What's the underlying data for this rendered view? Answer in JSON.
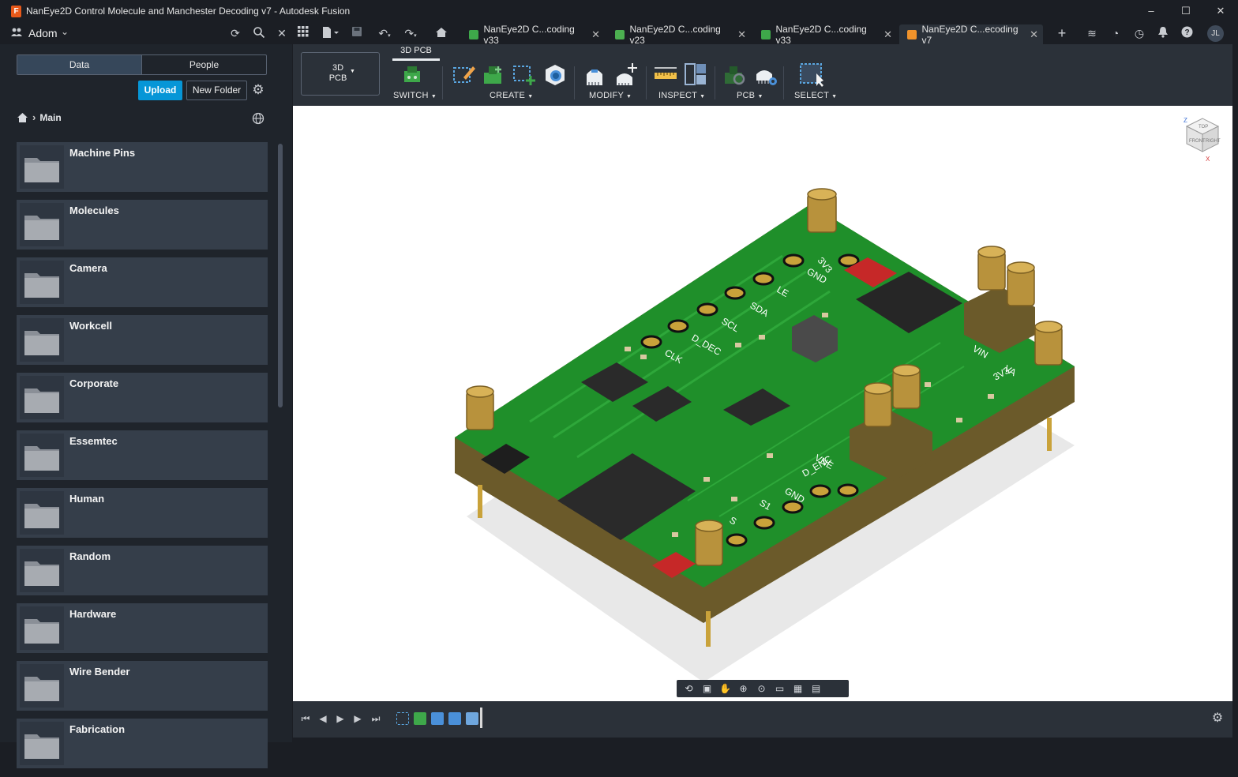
{
  "window": {
    "title": "NanEye2D Control Molecule and Manchester Decoding v7 - Autodesk Fusion",
    "app_icon": "F",
    "controls": [
      "–",
      "☐",
      "✕"
    ]
  },
  "tabbar": {
    "workspace": "Adom",
    "user_initials": "JL",
    "tabs": [
      {
        "label": "NanEye2D C...coding v33",
        "icon": "pcb-schematic-icon",
        "color": "#3ea84a",
        "active": false
      },
      {
        "label": "NanEye2D C...coding v23",
        "icon": "schematic-icon",
        "color": "#4caf50",
        "active": false
      },
      {
        "label": "NanEye2D C...coding v33",
        "icon": "pcb-icon",
        "color": "#3ea84a",
        "active": false
      },
      {
        "label": "NanEye2D C...ecoding v7",
        "icon": "3d-design-icon",
        "color": "#f0932b",
        "active": true
      }
    ]
  },
  "data_panel": {
    "segments": [
      "Data",
      "People"
    ],
    "active_segment": "Data",
    "upload_label": "Upload",
    "new_folder_label": "New Folder",
    "breadcrumb": [
      "Main"
    ],
    "folders": [
      "Machine Pins",
      "Molecules",
      "Camera",
      "Workcell",
      "Corporate",
      "Essemtec",
      "Human",
      "Random",
      "Hardware",
      "Wire Bender",
      "Fabrication"
    ]
  },
  "toolbar": {
    "workspace_switch": {
      "line1": "3D",
      "line2": "PCB"
    },
    "active_tab": "3D PCB",
    "groups": [
      "SWITCH",
      "CREATE",
      "MODIFY",
      "INSPECT",
      "PCB",
      "SELECT"
    ]
  },
  "viewport": {
    "background": "#ffffff",
    "board_color": "#1f8f2a",
    "silkscreen_labels": [
      "3V3",
      "GND",
      "LE",
      "SDA",
      "SCL",
      "D_DEC",
      "CLK",
      "VIN",
      "VA",
      "3V3",
      "VNE",
      "D_ENC",
      "GND",
      "S1",
      "S"
    ],
    "viewcube_labels": [
      "Z",
      "TOP",
      "FRONT",
      "RIGHT",
      "X"
    ]
  }
}
